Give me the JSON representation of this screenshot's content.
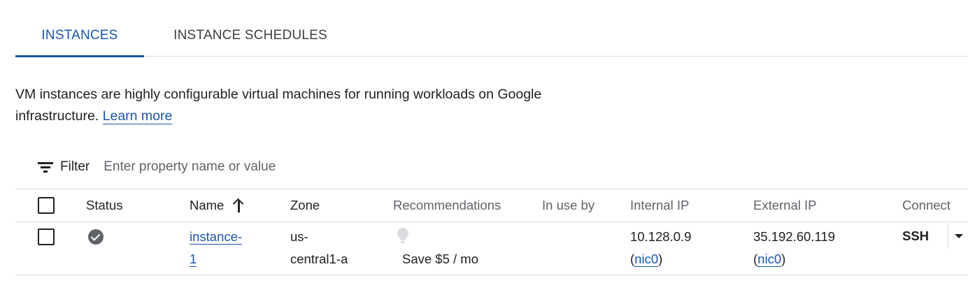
{
  "tabs": [
    {
      "label": "INSTANCES",
      "active": true
    },
    {
      "label": "INSTANCE SCHEDULES",
      "active": false
    }
  ],
  "description": {
    "text": "VM instances are highly configurable virtual machines for running workloads on Google infrastructure.",
    "link_label": "Learn more"
  },
  "filter": {
    "label": "Filter",
    "placeholder": "Enter property name or value",
    "icon": "filter-list-icon"
  },
  "table": {
    "columns": {
      "status": "Status",
      "name": "Name",
      "zone": "Zone",
      "recommendations": "Recommendations",
      "in_use_by": "In use by",
      "internal_ip": "Internal IP",
      "external_ip": "External IP",
      "connect": "Connect"
    },
    "sort": {
      "column": "Name",
      "direction": "ascending",
      "icon": "arrow-upward-icon"
    },
    "rows": [
      {
        "status_icon": "check-circle-icon",
        "name_line1": "instance-",
        "name_line2": "1",
        "zone_line1": "us-",
        "zone_line2": "central1-a",
        "recommendation_icon": "lightbulb-icon",
        "recommendation": "Save $5 / mo",
        "in_use_by": "",
        "internal_ip": "10.128.0.9",
        "internal_nic": "nic0",
        "external_ip": "35.192.60.119",
        "external_nic": "nic0",
        "connect_label": "SSH"
      }
    ]
  },
  "colors": {
    "accent": "#1a56a8",
    "divider": "#dadce0",
    "status_icon": "#5f6368"
  }
}
